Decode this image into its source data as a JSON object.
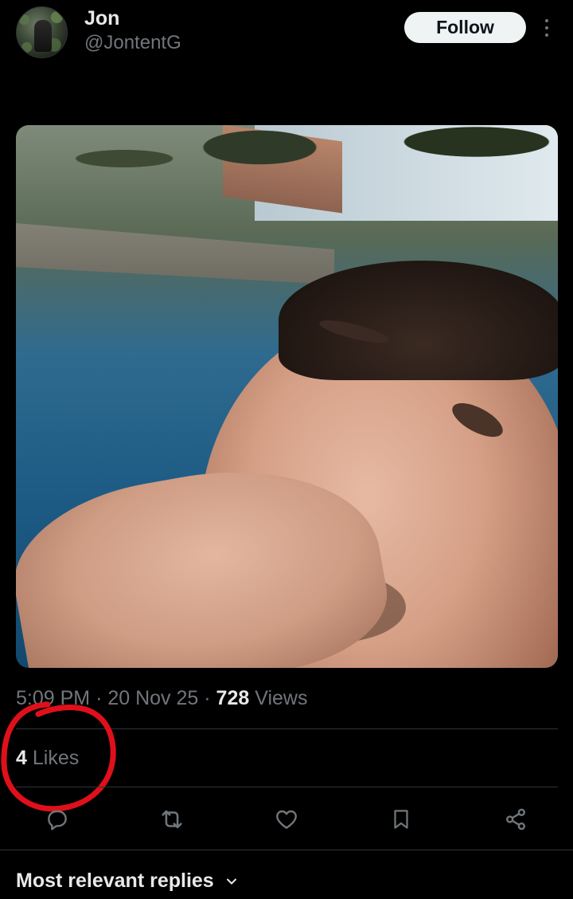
{
  "author": {
    "name": "Jon",
    "handle": "@JontentG",
    "follow_label": "Follow"
  },
  "tweet": {
    "time": "5:09 PM",
    "separator": "·",
    "date": "20 Nov 25",
    "views_count": "728",
    "views_label": "Views",
    "likes_count": "4",
    "likes_label": "Likes"
  },
  "actions": [
    "reply-icon",
    "retweet-icon",
    "like-icon",
    "bookmark-icon",
    "share-icon"
  ],
  "replies": {
    "sort_label": "Most relevant replies"
  },
  "colors": {
    "background": "#000000",
    "text_primary": "#e7e9ea",
    "text_secondary": "#71767b",
    "divider": "#2f3336",
    "annotation": "#e0101a"
  }
}
